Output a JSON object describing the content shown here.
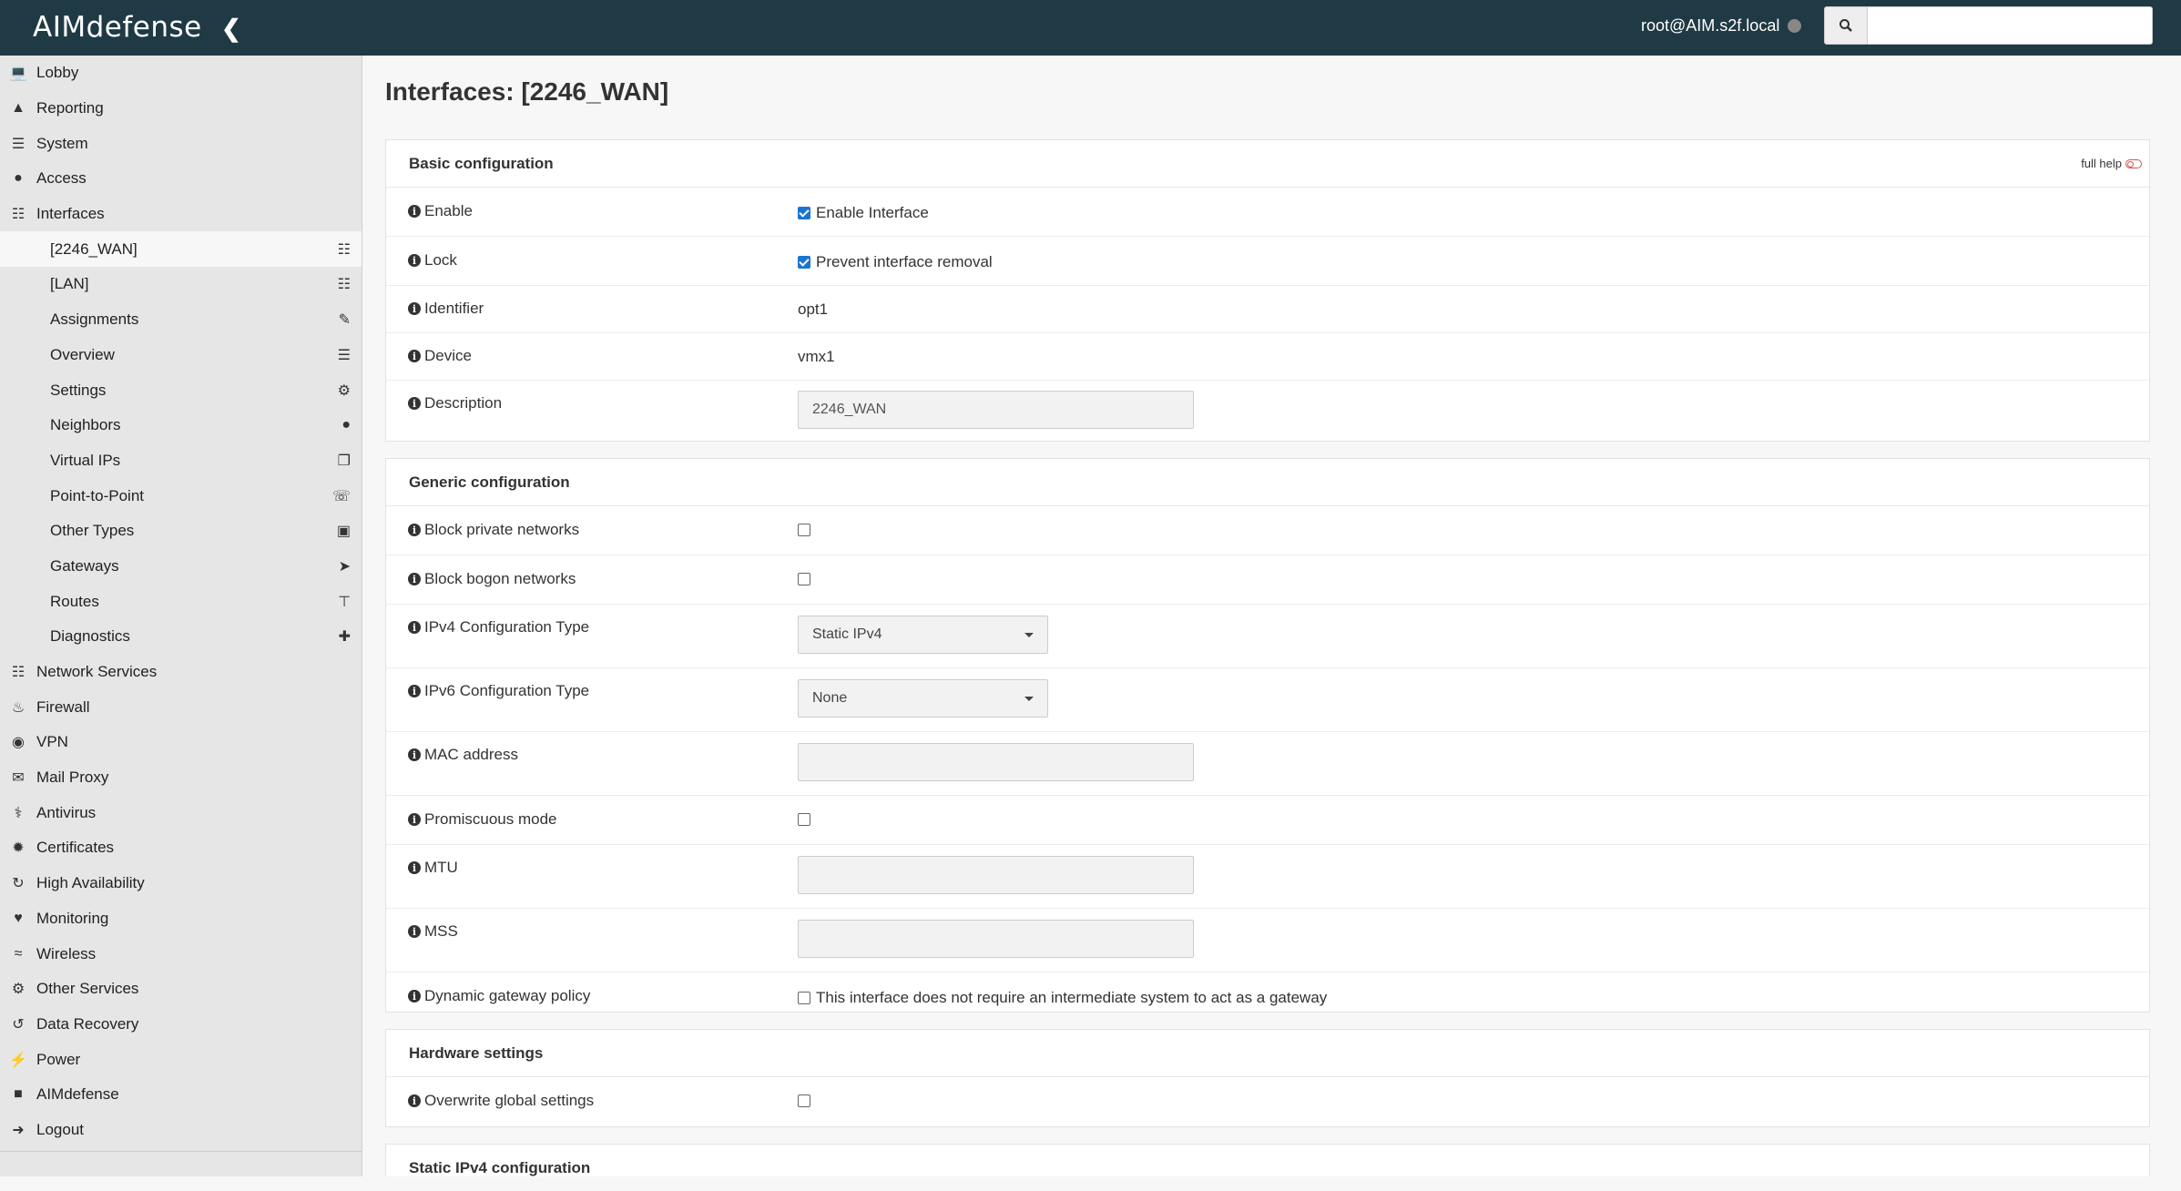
{
  "header": {
    "logo": "AIMdefense",
    "user": "root@AIM.s2f.local",
    "search_placeholder": ""
  },
  "sidebar": {
    "items": [
      {
        "label": "Lobby",
        "icon": "laptop-icon"
      },
      {
        "label": "Reporting",
        "icon": "area-chart-icon"
      },
      {
        "label": "System",
        "icon": "server-icon"
      },
      {
        "label": "Access",
        "icon": "users-icon"
      },
      {
        "label": "Interfaces",
        "icon": "sitemap-icon"
      }
    ],
    "sub_items": [
      {
        "label": "[2246_WAN]",
        "icon": "sitemap-icon",
        "active": true
      },
      {
        "label": "[LAN]",
        "icon": "sitemap-icon"
      },
      {
        "label": "Assignments",
        "icon": "pencil-icon"
      },
      {
        "label": "Overview",
        "icon": "tasks-icon"
      },
      {
        "label": "Settings",
        "icon": "cogs-icon"
      },
      {
        "label": "Neighbors",
        "icon": "users-icon"
      },
      {
        "label": "Virtual IPs",
        "icon": "clone-icon"
      },
      {
        "label": "Point-to-Point",
        "icon": "phone-icon"
      },
      {
        "label": "Other Types",
        "icon": "archive-icon"
      },
      {
        "label": "Gateways",
        "icon": "location-arrow-icon"
      },
      {
        "label": "Routes",
        "icon": "map-signs-icon"
      },
      {
        "label": "Diagnostics",
        "icon": "medkit-icon"
      }
    ],
    "items_after": [
      {
        "label": "Network Services",
        "icon": "sitemap-icon"
      },
      {
        "label": "Firewall",
        "icon": "fire-icon"
      },
      {
        "label": "VPN",
        "icon": "globe-icon"
      },
      {
        "label": "Mail Proxy",
        "icon": "envelope-icon"
      },
      {
        "label": "Antivirus",
        "icon": "stethoscope-icon"
      },
      {
        "label": "Certificates",
        "icon": "certificate-icon"
      },
      {
        "label": "High Availability",
        "icon": "refresh-icon"
      },
      {
        "label": "Monitoring",
        "icon": "heartbeat-icon"
      },
      {
        "label": "Wireless",
        "icon": "wifi-icon"
      },
      {
        "label": "Other Services",
        "icon": "cog-icon"
      },
      {
        "label": "Data Recovery",
        "icon": "history-icon"
      },
      {
        "label": "Power",
        "icon": "plug-icon"
      },
      {
        "label": "AIMdefense",
        "icon": "lock-icon"
      },
      {
        "label": "Logout",
        "icon": "sign-out-icon"
      }
    ]
  },
  "main": {
    "title": "Interfaces: [2246_WAN]",
    "full_help": "full help",
    "basic": {
      "heading": "Basic configuration",
      "enable_label": "Enable",
      "enable_text": "Enable Interface",
      "lock_label": "Lock",
      "lock_text": "Prevent interface removal",
      "identifier_label": "Identifier",
      "identifier_value": "opt1",
      "device_label": "Device",
      "device_value": "vmx1",
      "description_label": "Description",
      "description_value": "2246_WAN"
    },
    "generic": {
      "heading": "Generic configuration",
      "block_private_label": "Block private networks",
      "block_bogon_label": "Block bogon networks",
      "ipv4_label": "IPv4 Configuration Type",
      "ipv4_value": "Static IPv4",
      "ipv6_label": "IPv6 Configuration Type",
      "ipv6_value": "None",
      "mac_label": "MAC address",
      "mac_value": "",
      "promisc_label": "Promiscuous mode",
      "mtu_label": "MTU",
      "mtu_value": "",
      "mss_label": "MSS",
      "mss_value": "",
      "dgw_label": "Dynamic gateway policy",
      "dgw_text": "This interface does not require an intermediate system to act as a gateway"
    },
    "hardware": {
      "heading": "Hardware settings",
      "overwrite_label": "Overwrite global settings"
    },
    "static_ipv4": {
      "heading": "Static IPv4 configuration"
    }
  }
}
